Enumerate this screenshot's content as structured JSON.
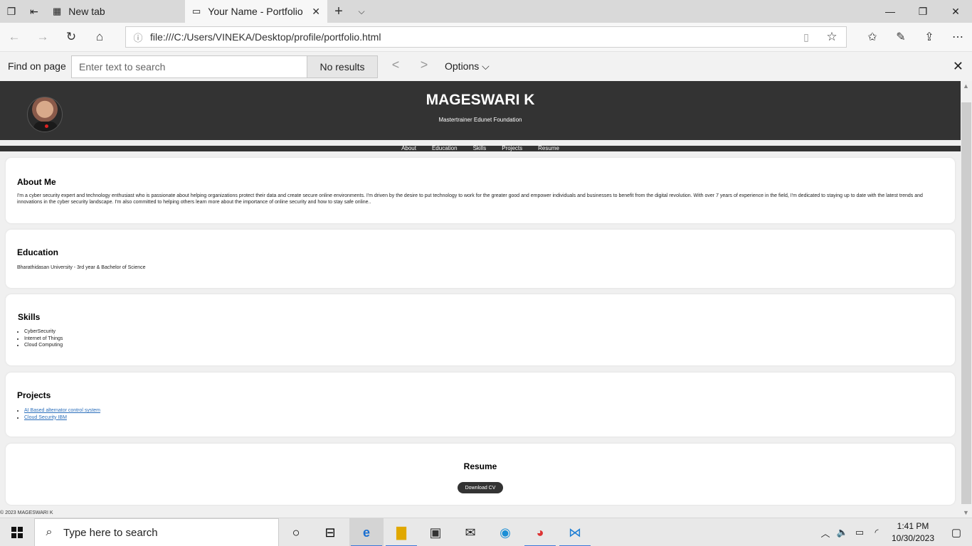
{
  "browser": {
    "tabs": [
      {
        "label": "New tab",
        "active": false
      },
      {
        "label": "Your Name - Portfolio",
        "active": true
      }
    ],
    "url": "file:///C:/Users/VINEKA/Desktop/profile/portfolio.html"
  },
  "find_bar": {
    "label": "Find on page",
    "placeholder": "Enter text to search",
    "results": "No results",
    "options_label": "Options"
  },
  "site": {
    "name": "MAGESWARI K",
    "tagline": "Mastertrainer Edunet Foundation",
    "nav": [
      "About",
      "Education",
      "Skills",
      "Projects",
      "Resume"
    ],
    "about": {
      "heading": "About Me",
      "text": "I'm a cyber security expert and technology enthusiast who is passionate about helping organizations protect their data and create secure online environments. I'm driven by the desire to put technology to work for the greater good and empower individuals and businesses to benefit from the digital revolution. With over 7 years of experience in the field, I'm dedicated to staying up to date with the latest trends and innovations in the cyber security landscape. I'm also committed to helping others learn more about the importance of online security and how to stay safe online.."
    },
    "education": {
      "heading": "Education",
      "text": "Bharathidasan University - 3rd year & Bachelor of Science"
    },
    "skills": {
      "heading": "Skills",
      "items": [
        "CyberSecurity",
        "Internet of Things",
        "Cloud Computing"
      ]
    },
    "projects": {
      "heading": "Projects",
      "items": [
        "AI Based alternator control system",
        "Cloud Security IBM"
      ]
    },
    "resume": {
      "heading": "Resume",
      "button": "Download CV"
    },
    "footer": "© 2023 MAGESWARI K"
  },
  "taskbar": {
    "search_placeholder": "Type here to search",
    "time": "1:41 PM",
    "date": "10/30/2023"
  }
}
